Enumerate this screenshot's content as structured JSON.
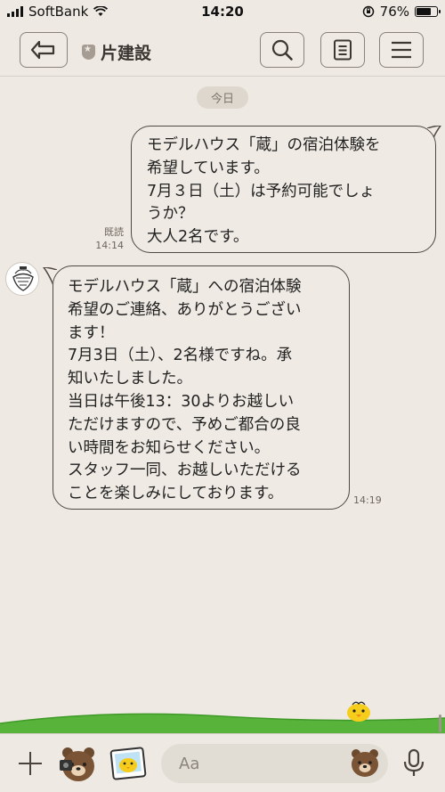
{
  "status_bar": {
    "carrier": "SoftBank",
    "time": "14:20",
    "battery_percent": "76%",
    "battery_level": 0.76
  },
  "header": {
    "title": "片建設",
    "icons": [
      "back-arrow-icon",
      "shield-icon",
      "search-icon",
      "note-icon",
      "menu-icon"
    ]
  },
  "chat": {
    "date_label": "今日",
    "messages": [
      {
        "direction": "outgoing",
        "text": "モデルハウス「蔵」の宿泊体験を\n希望しています。\n7月３日（土）は予約可能でしょ\nうか？\n大人2名です。",
        "read_label": "既読",
        "time": "14:14"
      },
      {
        "direction": "incoming",
        "text": "モデルハウス「蔵」への宿泊体験\n希望のご連絡、ありがとうござい\nます！\n7月3日（土）、2名様ですね。承\n知いたしました。\n当日は午後13：30よりお越しい\nただけますので、予めご都合の良\nい時間をお知らせください。\nスタッフ一同、お越しいただける\nことを楽しみにしております。",
        "time": "14:19"
      }
    ]
  },
  "input_bar": {
    "placeholder": "Aa"
  },
  "colors": {
    "background": "#eee9e2",
    "bubble_border": "#504842",
    "bubble_fill": "#efeae3",
    "grass": "#58b33b"
  }
}
